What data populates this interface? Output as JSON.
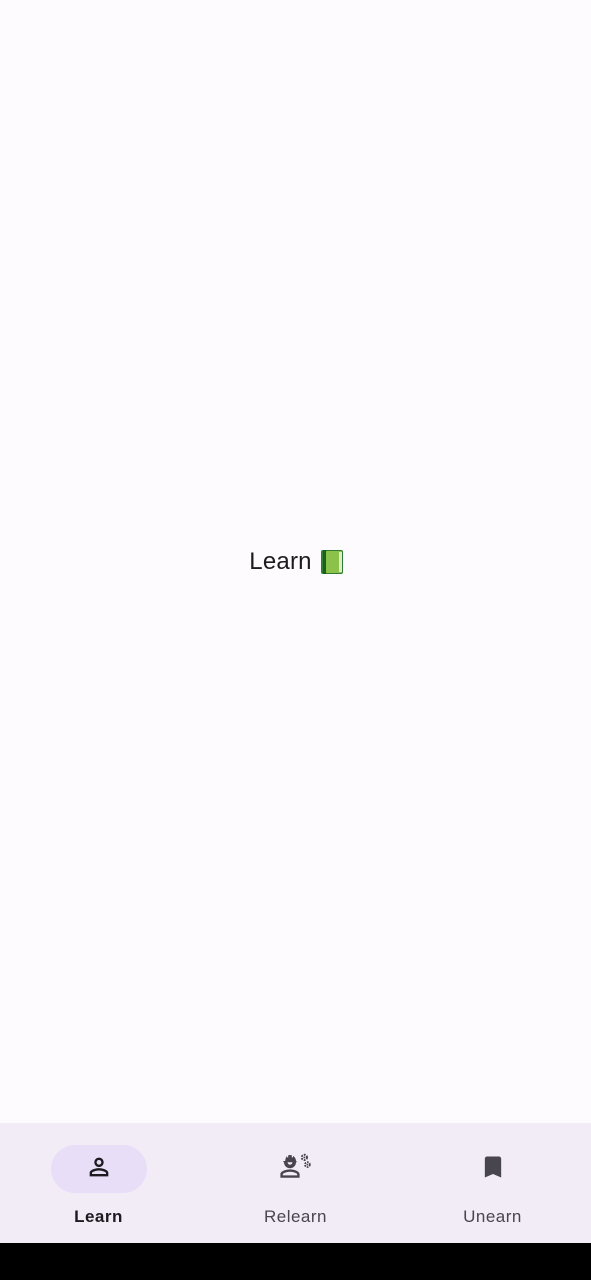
{
  "main": {
    "title": "Learn",
    "title_icon": "green-book-icon"
  },
  "bottom_nav": {
    "items": [
      {
        "label": "Learn",
        "icon": "person-icon",
        "active": true
      },
      {
        "label": "Relearn",
        "icon": "engineering-icon",
        "active": false
      },
      {
        "label": "Unearn",
        "icon": "bookmark-icon",
        "active": false
      }
    ]
  },
  "colors": {
    "background": "#fefbfe",
    "nav_background": "#f2ecf6",
    "active_indicator": "#e8def8",
    "icon": "#49454f",
    "active_icon": "#1d1b20"
  }
}
